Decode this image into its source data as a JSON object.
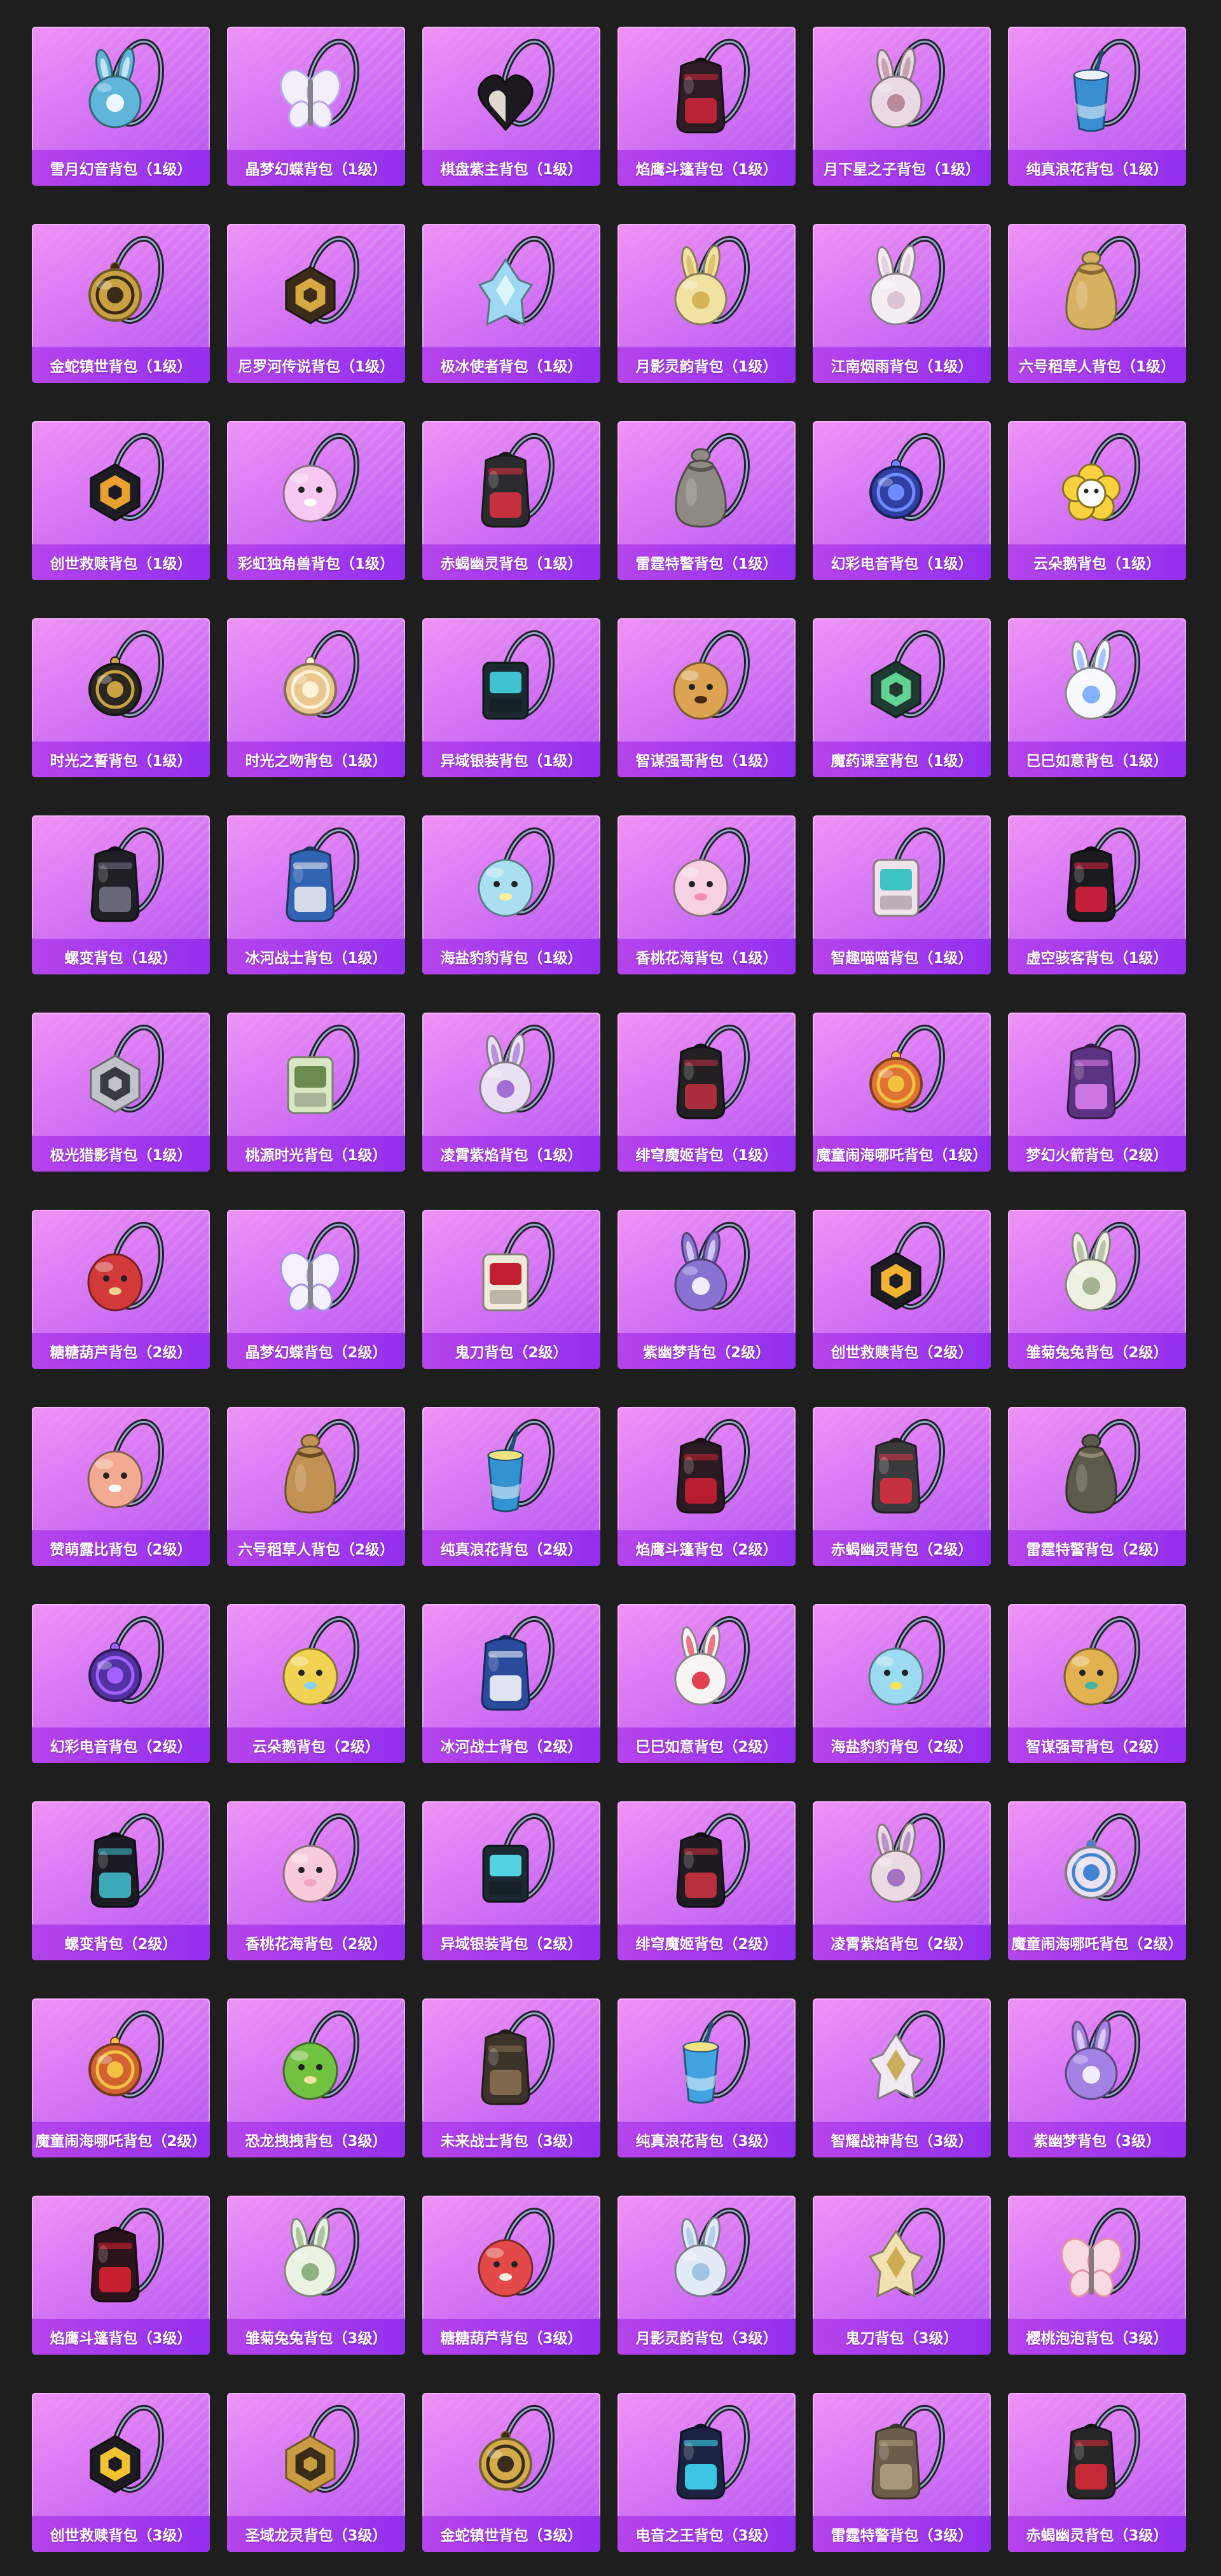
{
  "page": {
    "background": "#1e1e1e"
  },
  "items": [
    {
      "label": "雪月幻音背包（1级）",
      "icon": "bunny-backpack-icon",
      "color": "#5fb6da",
      "accent": "#eef6ff"
    },
    {
      "label": "晶梦幻蝶背包（1级）",
      "icon": "butterfly-backpack-icon",
      "color": "#f2eefa",
      "accent": "#b9a6ee"
    },
    {
      "label": "棋盘紫主背包（1级）",
      "icon": "heart-backpack-icon",
      "color": "#1c1a1e",
      "accent": "#f4eee6"
    },
    {
      "label": "焰鹰斗篷背包（1级）",
      "icon": "rucksack-backpack-icon",
      "color": "#2e1c24",
      "accent": "#d2243a"
    },
    {
      "label": "月下星之子背包（1级）",
      "icon": "bunny-backpack-icon",
      "color": "#ead8e2",
      "accent": "#b88a9a"
    },
    {
      "label": "纯真浪花背包（1级）",
      "icon": "cup-backpack-icon",
      "color": "#3a8fd2",
      "accent": "#eef2ff"
    },
    {
      "label": "金蛇镇世背包（1级）",
      "icon": "medallion-backpack-icon",
      "color": "#c9a142",
      "accent": "#3b2b18"
    },
    {
      "label": "尼罗河传说背包（1级）",
      "icon": "hexagon-backpack-icon",
      "color": "#3b2b1a",
      "accent": "#d6a842"
    },
    {
      "label": "极冰使者背包（1级）",
      "icon": "crystal-backpack-icon",
      "color": "#9ed8f2",
      "accent": "#e8fbff"
    },
    {
      "label": "月影灵韵背包（1级）",
      "icon": "bunny-backpack-icon",
      "color": "#f2e2a2",
      "accent": "#d6b45c"
    },
    {
      "label": "江南烟雨背包（1级）",
      "icon": "bunny-backpack-icon",
      "color": "#f4eef2",
      "accent": "#d8c6d2"
    },
    {
      "label": "六号稻草人背包（1级）",
      "icon": "sack-backpack-icon",
      "color": "#d8b062",
      "accent": "#8a6a30"
    },
    {
      "label": "创世救赎背包（1级）",
      "icon": "hexagon-backpack-icon",
      "color": "#1c1c22",
      "accent": "#e8a030"
    },
    {
      "label": "彩虹独角兽背包（1级）",
      "icon": "creature-backpack-icon",
      "color": "#f6c8f2",
      "accent": "#ffffff"
    },
    {
      "label": "赤蝎幽灵背包（1级）",
      "icon": "rucksack-backpack-icon",
      "color": "#2b2b2e",
      "accent": "#e03040"
    },
    {
      "label": "雷霆特警背包（1级）",
      "icon": "sack-backpack-icon",
      "color": "#8e8a82",
      "accent": "#5a5650"
    },
    {
      "label": "幻彩电音背包（1级）",
      "icon": "medallion-backpack-icon",
      "color": "#2f3fa2",
      "accent": "#6f8cff"
    },
    {
      "label": "云朵鹅背包（1级）",
      "icon": "flower-backpack-icon",
      "color": "#f7d23e",
      "accent": "#ffffff"
    },
    {
      "label": "时光之誓背包（1级）",
      "icon": "medallion-backpack-icon",
      "color": "#2a2620",
      "accent": "#c9a142"
    },
    {
      "label": "时光之吻背包（1级）",
      "icon": "medallion-backpack-icon",
      "color": "#e8c890",
      "accent": "#fff2d6"
    },
    {
      "label": "异域银装背包（1级）",
      "icon": "box-backpack-icon",
      "color": "#1b2a31",
      "accent": "#3fc2d2"
    },
    {
      "label": "智谋强哥背包（1级）",
      "icon": "creature-backpack-icon",
      "color": "#dba352",
      "accent": "#4a2812"
    },
    {
      "label": "魔药课室背包（1级）",
      "icon": "hexagon-backpack-icon",
      "color": "#1f3a31",
      "accent": "#62d292"
    },
    {
      "label": "巳巳如意背包（1级）",
      "icon": "bunny-backpack-icon",
      "color": "#f8f8ff",
      "accent": "#82b2ff"
    },
    {
      "label": "螺变背包（1级）",
      "icon": "rucksack-backpack-icon",
      "color": "#1f1f25",
      "accent": "#74748a"
    },
    {
      "label": "冰河战士背包（1级）",
      "icon": "rucksack-backpack-icon",
      "color": "#3262b2",
      "accent": "#f2f2f2"
    },
    {
      "label": "海盐豹豹背包（1级）",
      "icon": "creature-backpack-icon",
      "color": "#a8e0f2",
      "accent": "#fff0a0"
    },
    {
      "label": "香桃花海背包（1级）",
      "icon": "creature-backpack-icon",
      "color": "#f8d2e2",
      "accent": "#f08fb2"
    },
    {
      "label": "智趣喵喵背包（1级）",
      "icon": "box-backpack-icon",
      "color": "#f2e2ea",
      "accent": "#3fc2c2"
    },
    {
      "label": "虚空骇客背包（1级）",
      "icon": "rucksack-backpack-icon",
      "color": "#1b1b1f",
      "accent": "#e02040"
    },
    {
      "label": "极光猎影背包（1级）",
      "icon": "hexagon-backpack-icon",
      "color": "#c2c2ca",
      "accent": "#3a3a42"
    },
    {
      "label": "桃源时光背包（1级）",
      "icon": "box-backpack-icon",
      "color": "#d8e8c2",
      "accent": "#6a8a50"
    },
    {
      "label": "凌霄紫焰背包（1级）",
      "icon": "bunny-backpack-icon",
      "color": "#e9e0f2",
      "accent": "#a270d2"
    },
    {
      "label": "绯穹魔姬背包（1级）",
      "icon": "rucksack-backpack-icon",
      "color": "#222022",
      "accent": "#c23042"
    },
    {
      "label": "魔童闹海哪吒背包（1级）",
      "icon": "medallion-backpack-icon",
      "color": "#e07232",
      "accent": "#f2c242"
    },
    {
      "label": "梦幻火箭背包（2级）",
      "icon": "rucksack-backpack-icon",
      "color": "#5c3282",
      "accent": "#e282f2"
    },
    {
      "label": "糖糖葫芦背包（2级）",
      "icon": "creature-backpack-icon",
      "color": "#d23a3a",
      "accent": "#f2d292"
    },
    {
      "label": "晶梦幻蝶背包（2级）",
      "icon": "butterfly-backpack-icon",
      "color": "#f4f0ff",
      "accent": "#a292e2"
    },
    {
      "label": "鬼刀背包（2级）",
      "icon": "box-backpack-icon",
      "color": "#f2eada",
      "accent": "#c22032"
    },
    {
      "label": "紫幽梦背包（2级）",
      "icon": "bunny-backpack-icon",
      "color": "#8a72d2",
      "accent": "#f2eaff"
    },
    {
      "label": "创世救赎背包（2级）",
      "icon": "hexagon-backpack-icon",
      "color": "#1c1c22",
      "accent": "#f2b232"
    },
    {
      "label": "雏菊兔兔背包（2级）",
      "icon": "bunny-backpack-icon",
      "color": "#eef0e2",
      "accent": "#a2b292"
    },
    {
      "label": "赞萌露比背包（2级）",
      "icon": "creature-backpack-icon",
      "color": "#f2aa92",
      "accent": "#ffffff"
    },
    {
      "label": "六号稻草人背包（2级）",
      "icon": "sack-backpack-icon",
      "color": "#c29252",
      "accent": "#6a4a22"
    },
    {
      "label": "纯真浪花背包（2级）",
      "icon": "cup-backpack-icon",
      "color": "#3292d2",
      "accent": "#f2e282"
    },
    {
      "label": "焰鹰斗篷背包（2级）",
      "icon": "rucksack-backpack-icon",
      "color": "#2c1a22",
      "accent": "#d22032"
    },
    {
      "label": "赤蝎幽灵背包（2级）",
      "icon": "rucksack-backpack-icon",
      "color": "#3a3a3c",
      "accent": "#e03040"
    },
    {
      "label": "雷霆特警背包（2级）",
      "icon": "sack-backpack-icon",
      "color": "#5c5a4a",
      "accent": "#928a72"
    },
    {
      "label": "幻彩电音背包（2级）",
      "icon": "medallion-backpack-icon",
      "color": "#5232a2",
      "accent": "#a262ff"
    },
    {
      "label": "云朵鹅背包（2级）",
      "icon": "creature-backpack-icon",
      "color": "#f2d252",
      "accent": "#82d2f2"
    },
    {
      "label": "冰河战士背包（2级）",
      "icon": "rucksack-backpack-icon",
      "color": "#2a4a9c",
      "accent": "#ffffff"
    },
    {
      "label": "巳巳如意背包（2级）",
      "icon": "bunny-backpack-icon",
      "color": "#f8f4f4",
      "accent": "#e24252"
    },
    {
      "label": "海盐豹豹背包（2级）",
      "icon": "creature-backpack-icon",
      "color": "#9cdaf2",
      "accent": "#f2e262"
    },
    {
      "label": "智谋强哥背包（2级）",
      "icon": "creature-backpack-icon",
      "color": "#e2b252",
      "accent": "#42b2a2"
    },
    {
      "label": "螺变背包（2级）",
      "icon": "rucksack-backpack-icon",
      "color": "#1b1b23",
      "accent": "#42c2d2"
    },
    {
      "label": "香桃花海背包（2级）",
      "icon": "creature-backpack-icon",
      "color": "#f8cadb",
      "accent": "#f2a2c2"
    },
    {
      "label": "异域银装背包（2级）",
      "icon": "box-backpack-icon",
      "color": "#1b2a32",
      "accent": "#52d2e2"
    },
    {
      "label": "绯穹魔姬背包（2级）",
      "icon": "rucksack-backpack-icon",
      "color": "#201b22",
      "accent": "#d23242"
    },
    {
      "label": "凌霄紫焰背包（2级）",
      "icon": "bunny-backpack-icon",
      "color": "#eadae2",
      "accent": "#a272c2"
    },
    {
      "label": "魔童闹海哪吒背包（2级）",
      "icon": "medallion-backpack-icon",
      "color": "#eae2f2",
      "accent": "#4282d2"
    },
    {
      "label": "魔童闹海哪吒背包（2级）",
      "icon": "medallion-backpack-icon",
      "color": "#d26232",
      "accent": "#f2c242"
    },
    {
      "label": "恐龙拽拽背包（3级）",
      "icon": "creature-backpack-icon",
      "color": "#72c242",
      "accent": "#f2e2a2"
    },
    {
      "label": "未来战士背包（3级）",
      "icon": "rucksack-backpack-icon",
      "color": "#3b322a",
      "accent": "#8c7252"
    },
    {
      "label": "纯真浪花背包（3级）",
      "icon": "cup-backpack-icon",
      "color": "#42a2e2",
      "accent": "#f2e282"
    },
    {
      "label": "智耀战神背包（3级）",
      "icon": "crystal-backpack-icon",
      "color": "#f2eaf2",
      "accent": "#c2a242"
    },
    {
      "label": "紫幽梦背包（3级）",
      "icon": "bunny-backpack-icon",
      "color": "#a282e2",
      "accent": "#f2eaff"
    },
    {
      "label": "焰鹰斗篷背包（3级）",
      "icon": "rucksack-backpack-icon",
      "color": "#2c121a",
      "accent": "#e22232"
    },
    {
      "label": "雏菊兔兔背包（3级）",
      "icon": "bunny-backpack-icon",
      "color": "#eaf2e2",
      "accent": "#92b282"
    },
    {
      "label": "糖糖葫芦背包（3级）",
      "icon": "creature-backpack-icon",
      "color": "#e24a4a",
      "accent": "#f8eae2"
    },
    {
      "label": "月影灵韵背包（3级）",
      "icon": "bunny-backpack-icon",
      "color": "#e2eaf8",
      "accent": "#a2c2e2"
    },
    {
      "label": "鬼刀背包（3级）",
      "icon": "crystal-backpack-icon",
      "color": "#f2e2b2",
      "accent": "#c9a142"
    },
    {
      "label": "樱桃泡泡背包（3级）",
      "icon": "butterfly-backpack-icon",
      "color": "#f8dae2",
      "accent": "#e292a2"
    },
    {
      "label": "创世救赎背包（3级）",
      "icon": "hexagon-backpack-icon",
      "color": "#1b1b21",
      "accent": "#f2c232"
    },
    {
      "label": "圣域龙灵背包（3级）",
      "icon": "hexagon-backpack-icon",
      "color": "#ca9c42",
      "accent": "#3b2b1a"
    },
    {
      "label": "金蛇镇世背包（3级）",
      "icon": "medallion-backpack-icon",
      "color": "#d2aa4a",
      "accent": "#3b2b1a"
    },
    {
      "label": "电音之王背包（3级）",
      "icon": "rucksack-backpack-icon",
      "color": "#1b2242",
      "accent": "#42e2ff"
    },
    {
      "label": "雷霆特警背包（3级）",
      "icon": "rucksack-backpack-icon",
      "color": "#6c5c4a",
      "accent": "#b2a282"
    },
    {
      "label": "赤蝎幽灵背包（3级）",
      "icon": "rucksack-backpack-icon",
      "color": "#272727",
      "accent": "#e22a3a"
    }
  ]
}
